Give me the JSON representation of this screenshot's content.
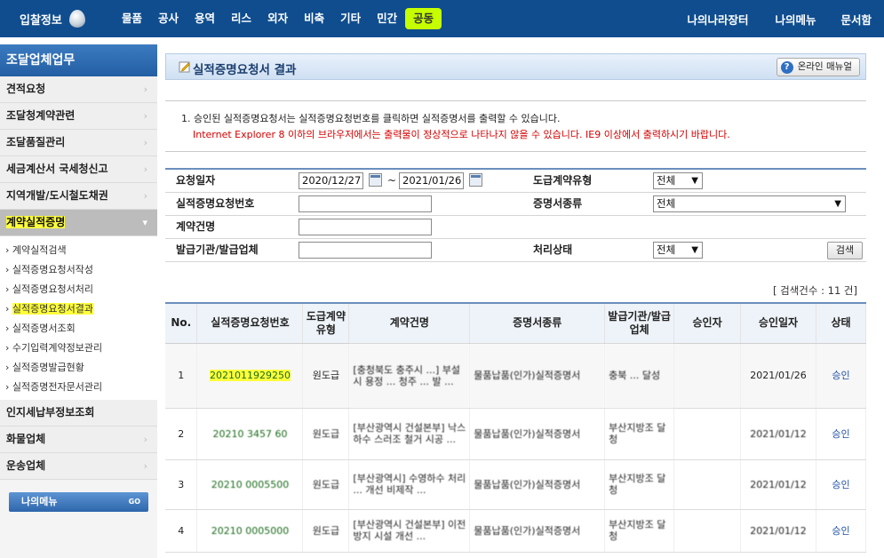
{
  "topnav": {
    "brand": "입찰정보",
    "menu": [
      "물품",
      "공사",
      "용역",
      "리스",
      "외자",
      "비축",
      "기타",
      "민간",
      "공동"
    ],
    "right": [
      "나의나라장터",
      "나의메뉴",
      "문서함"
    ]
  },
  "sidebar": {
    "title": "조달업체업무",
    "items": [
      {
        "label": "견적요청"
      },
      {
        "label": "조달청계약관련"
      },
      {
        "label": "조달품질관리"
      },
      {
        "label": "세금계산서 국세청신고"
      },
      {
        "label": "지역개발/도시철도채권"
      },
      {
        "label": "계약실적증명"
      }
    ],
    "sub": [
      "계약실적검색",
      "실적증명요청서작성",
      "실적증명요청서처리",
      "실적증명요청서결과",
      "실적증명서조회",
      "수기입력계약정보관리",
      "실적증명발급현황",
      "실적증명전자문서관리"
    ],
    "items2": [
      {
        "label": "인지세납부정보조회"
      },
      {
        "label": "화물업체"
      },
      {
        "label": "운송업체"
      }
    ],
    "mymenu": "나의메뉴",
    "mymenu_go": "GO"
  },
  "main": {
    "title": "실적증명요청서 결과",
    "manual": "온라인 매뉴얼",
    "notice1": "1. 승인된 실적증명요청서는 실적증명요청번호를 클릭하면 실적증명서를 출력할 수 있습니다.",
    "notice2": "Internet Explorer 8 이하의 브라우저에서는 출력물이 정상적으로 나타나지 않을 수 있습니다. IE9 이상에서 출력하시기 바랍니다."
  },
  "search": {
    "req_date_label": "요청일자",
    "date_from": "2020/12/27",
    "date_sep": "~",
    "date_to": "2021/01/26",
    "contract_type_label": "도급계약유형",
    "contract_type_value": "전체",
    "req_no_label": "실적증명요청번호",
    "cert_type_label": "증명서종류",
    "cert_type_value": "전체",
    "contract_name_label": "계약건명",
    "issuer_label": "발급기관/발급업체",
    "status_label": "처리상태",
    "status_value": "전체",
    "search_button": "검색"
  },
  "count_text": "[ 검색건수 : 11 건]",
  "table": {
    "headers": [
      "No.",
      "실적증명요청번호",
      "도급계약유형",
      "계약건명",
      "증명서종류",
      "발급기관/발급업체",
      "승인자",
      "승인일자",
      "상태"
    ],
    "rows": [
      {
        "no": "1",
        "req_no": "2021011929250",
        "type": "원도급",
        "name": "[충청북도 충주시 ...] 부설 시 용정 ... 청주 ... 발 ...",
        "cert": "물품납품(인가)실적증명서",
        "issuer": "충북 ... 달성",
        "approver": "",
        "date": "2021/01/26",
        "status": "승인"
      },
      {
        "no": "2",
        "req_no": "20210 3457 60",
        "type": "원도급",
        "name": "[부산광역시 건설본부] 낙스하수 스러조 철거 시공 ...",
        "cert": "물품납품(인가)실적증명서",
        "issuer": "부산지방조 달청",
        "approver": "",
        "date": "2021/01/12",
        "status": "승인"
      },
      {
        "no": "3",
        "req_no": "20210 0005500",
        "type": "원도급",
        "name": "[부산광역시] 수영하수 처리 ... 개선 비제작 ...",
        "cert": "물품납품(인가)실적증명서",
        "issuer": "부산지방조 달청",
        "approver": "",
        "date": "2021/01/12",
        "status": "승인"
      },
      {
        "no": "4",
        "req_no": "20210 0005000",
        "type": "원도급",
        "name": "[부산광역시 건설본부] 이전 방지 시설 개선 ...",
        "cert": "물품납품(인가)실적증명서",
        "issuer": "부산지방조 달청",
        "approver": "",
        "date": "2021/01/12",
        "status": "승인"
      }
    ]
  },
  "colors": {
    "nav": "#0f4d8f",
    "highlight": "#ffff3c",
    "green": "#1a6b1a",
    "red": "#d40000",
    "link": "#1e4fa8"
  }
}
